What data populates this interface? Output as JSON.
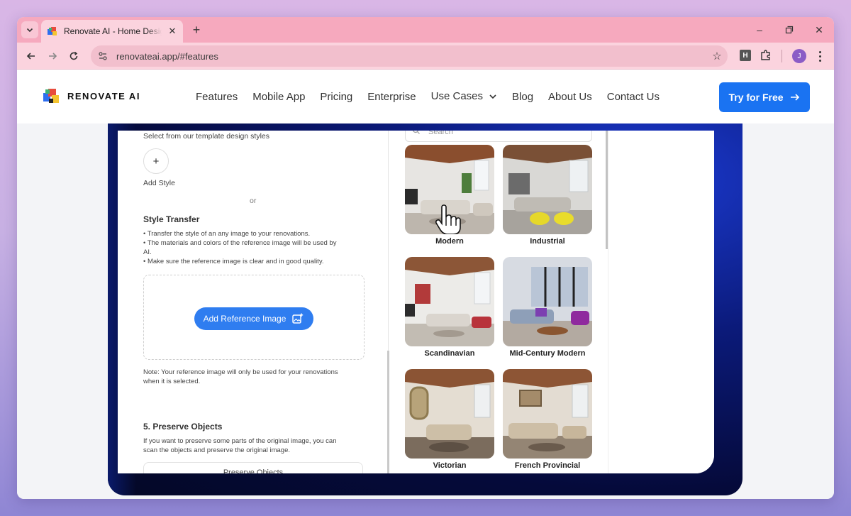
{
  "browser": {
    "tab_title": "Renovate AI - Home Design ide",
    "tab_close": "✕",
    "new_tab": "+",
    "url": "renovateai.app/#features",
    "profile_initial": "J",
    "extension_label": "H",
    "window_controls": [
      "–",
      "▢",
      "✕"
    ],
    "icons": [
      "tab-search-icon",
      "back-icon",
      "forward-icon",
      "reload-icon",
      "site-info-icon",
      "bookmark-star-icon",
      "extensions-icon",
      "kebab-menu-icon"
    ]
  },
  "site": {
    "logo_text": "RENOVATE AI",
    "nav": [
      "Features",
      "Mobile App",
      "Pricing",
      "Enterprise",
      "Use Cases",
      "Blog",
      "About Us",
      "Contact Us"
    ],
    "cta_label": "Try for Free",
    "accent": "#1a73f2"
  },
  "demo": {
    "select_styles_text": "Select from our template design styles",
    "add_style_plus": "+",
    "add_style_label": "Add Style",
    "or_text": "or",
    "style_transfer_title": "Style Transfer",
    "bullets": [
      "• Transfer the style of an any image to your renovations.",
      "• The materials and colors of the reference image will be used by",
      "AI.",
      "• Make sure the reference image is clear and in good quality."
    ],
    "ref_button_label": "Add Reference Image",
    "note_line1": "Note: Your reference image will only be used for your renovations",
    "note_line2": "when it is selected.",
    "preserve_title": "5. Preserve Objects",
    "preserve_line1": "If you want to preserve some parts of the original image, you can",
    "preserve_line2": "scan the objects and preserve the original image.",
    "preserve_button": "Preserve Objects",
    "search_placeholder": "Search",
    "styles": [
      {
        "label": "Modern",
        "selected": true
      },
      {
        "label": "Industrial",
        "selected": false
      },
      {
        "label": "Scandinavian",
        "selected": false
      },
      {
        "label": "Mid-Century Modern",
        "selected": false
      },
      {
        "label": "Victorian",
        "selected": false
      },
      {
        "label": "French Provincial",
        "selected": false
      }
    ]
  }
}
